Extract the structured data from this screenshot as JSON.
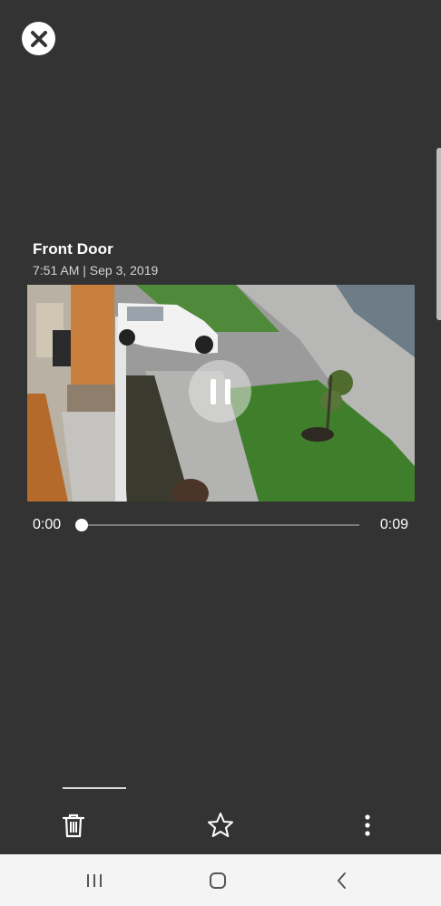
{
  "header": {
    "close_icon": "close-icon"
  },
  "event": {
    "camera_name": "Front Door",
    "timestamp": "7:51 AM | Sep 3, 2019"
  },
  "player": {
    "state_icon": "pause-icon",
    "current_time": "0:00",
    "total_time": "0:09",
    "progress": 0.0
  },
  "toolbar": {
    "delete_icon": "trash-icon",
    "favorite_icon": "star-icon",
    "more_icon": "more-vertical-icon",
    "active_indicator_color": "#d8d8d8"
  },
  "system_nav": {
    "recents_icon": "recents-icon",
    "home_icon": "home-icon",
    "back_icon": "back-icon"
  },
  "colors": {
    "background": "#333333",
    "nav_background": "#f4f4f4"
  }
}
